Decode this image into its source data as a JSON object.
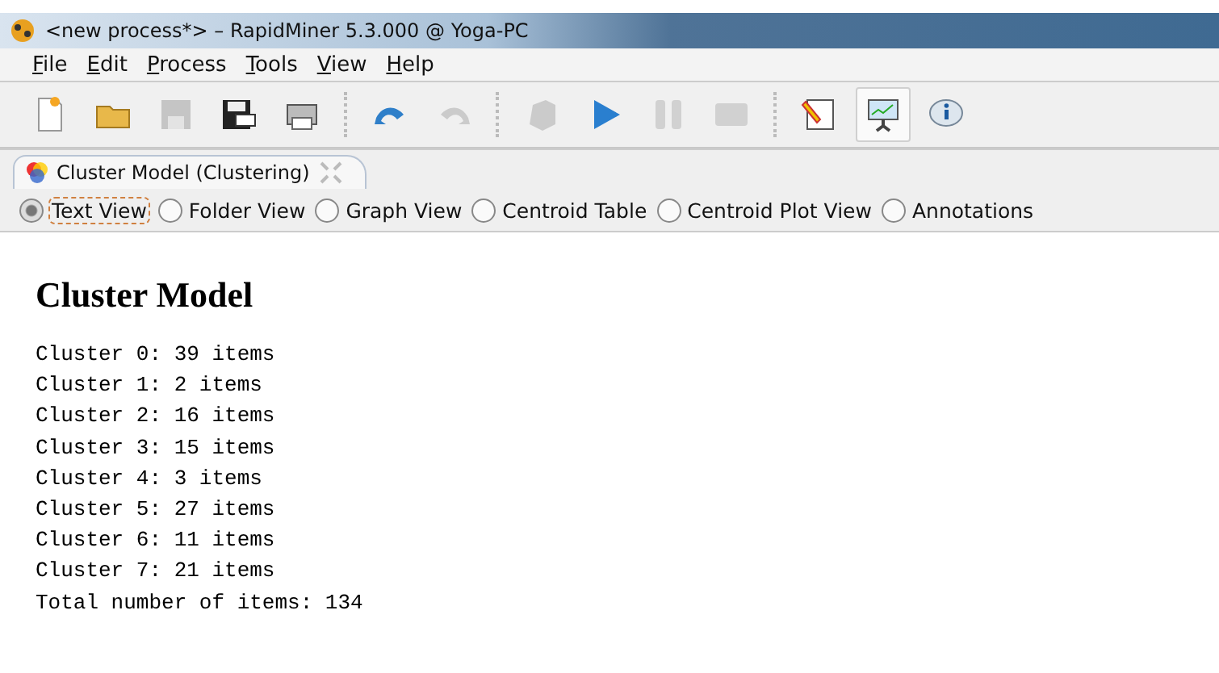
{
  "window": {
    "title": "<new process*> – RapidMiner 5.3.000 @ Yoga-PC"
  },
  "menu": [
    {
      "label": "File"
    },
    {
      "label": "Edit"
    },
    {
      "label": "Process"
    },
    {
      "label": "Tools"
    },
    {
      "label": "View"
    },
    {
      "label": "Help"
    }
  ],
  "toolbar": [
    {
      "kind": "new",
      "disabled": false,
      "selected": false
    },
    {
      "kind": "open",
      "disabled": false,
      "selected": false
    },
    {
      "kind": "save",
      "disabled": true,
      "selected": false
    },
    {
      "kind": "saveas",
      "disabled": false,
      "selected": false
    },
    {
      "kind": "print",
      "disabled": false,
      "selected": false
    },
    {
      "kind": "sep"
    },
    {
      "kind": "undo",
      "disabled": false,
      "selected": false
    },
    {
      "kind": "redo",
      "disabled": true,
      "selected": false
    },
    {
      "kind": "sep"
    },
    {
      "kind": "cube",
      "disabled": true,
      "selected": false
    },
    {
      "kind": "run",
      "disabled": false,
      "selected": false
    },
    {
      "kind": "pause",
      "disabled": true,
      "selected": false
    },
    {
      "kind": "stop",
      "disabled": true,
      "selected": false
    },
    {
      "kind": "sep"
    },
    {
      "kind": "notes",
      "disabled": false,
      "selected": false
    },
    {
      "kind": "results",
      "disabled": false,
      "selected": true
    },
    {
      "kind": "info",
      "disabled": false,
      "selected": false
    }
  ],
  "tab": {
    "label": "Cluster Model (Clustering)"
  },
  "views": [
    {
      "label": "Text View",
      "selected": true
    },
    {
      "label": "Folder View",
      "selected": false
    },
    {
      "label": "Graph View",
      "selected": false
    },
    {
      "label": "Centroid Table",
      "selected": false
    },
    {
      "label": "Centroid Plot View",
      "selected": false
    },
    {
      "label": "Annotations",
      "selected": false
    }
  ],
  "content": {
    "heading": "Cluster Model",
    "lines": [
      "Cluster 0: 39 items",
      "Cluster 1: 2 items",
      "Cluster 2: 16 items",
      "Cluster 3: 15 items",
      "Cluster 4: 3 items",
      "Cluster 5: 27 items",
      "Cluster 6: 11 items",
      "Cluster 7: 21 items",
      "Total number of items: 134"
    ]
  }
}
